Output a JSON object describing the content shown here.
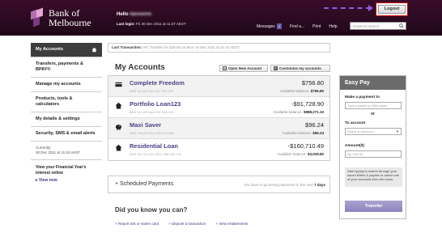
{
  "header": {
    "brand": "Bank of Melbourne",
    "greeting": "Hello",
    "user_name": "Naveenm",
    "last_login_label": "Last login:",
    "last_login_value": "Fri 30 Dec 2011 at 11:37 AEST",
    "nav": [
      "Messages",
      "Find a...",
      "Print",
      "Help"
    ],
    "messages_count": "1",
    "search_placeholder": "Keyword search",
    "logout_label": "Logout"
  },
  "sidebar": {
    "items": [
      "My Accounts",
      "Transfers, payments & BPAY®",
      "Manage my accounts",
      "Products, tools & calculators",
      "My details & settings",
      "Security, SMS & email alerts"
    ],
    "currently_label": "Currently:",
    "currently_value": "30 Dec 2011 at 11:53 AEST",
    "fy_link": "View your Financial Year's interest online",
    "view_now": "View now"
  },
  "transaction_bar": {
    "label": "Last Transaction:",
    "value": "A/C Transfer for $26.00 on Mon 19 Dec 2011 at 21:42 AEST"
  },
  "main": {
    "title": "My Accounts",
    "open_account": "Open New Account",
    "customise": "Customise my accounts",
    "accounts": [
      {
        "name": "Complete Freedom",
        "bsb": "BSB 112-879  Acc 457 192 407",
        "balance": "$756.80",
        "avail_label": "Available balance:",
        "avail": "$756.80",
        "icon": "card-icon"
      },
      {
        "name": "Portfolio Loan123",
        "bsb": "BSB 112-879  Acc 551 538 413",
        "balance": "-$91,728.90",
        "avail_label": "Available balance:",
        "avail": "$988,271.10",
        "icon": "house-icon"
      },
      {
        "name": "Maxi Saver",
        "bsb": "BSB 100-879  Acc 053 273 646",
        "balance": "$96.24",
        "avail_label": "Available balance:",
        "avail": "$96.24",
        "icon": "piggy-bank-icon"
      },
      {
        "name": "Residential Loan",
        "bsb": "BSB 112-911  Acc 3311 288 530 176",
        "balance": "-$160,710.49",
        "avail_label": "Available balance:",
        "avail": "$3,029.80",
        "icon": "house-icon"
      }
    ],
    "scheduled_label": "Scheduled Payments",
    "scheduled_note_pre": "You have",
    "scheduled_count": "0",
    "scheduled_note_mid": "upcoming payments in the next",
    "scheduled_days": "7 days",
    "dyk_title": "Did you know you can?",
    "dyk_links": [
      "Report lost or stolen card",
      "Dispute a transaction",
      "View eStatements"
    ]
  },
  "easypay": {
    "title": "Easy Pay",
    "payment_to_label": "Make a payment to",
    "payee_placeholder": "Type a payee or biller name",
    "or": "or",
    "to_account_label": "To account",
    "account_select": "Select an account...",
    "amount_label": "Amount($)",
    "amount_placeholder": "eg: 100.00",
    "tip": "Start typing to search through your saved billers & payees or select one of your accounts from the menu.",
    "transfer_button": "Transfer"
  }
}
